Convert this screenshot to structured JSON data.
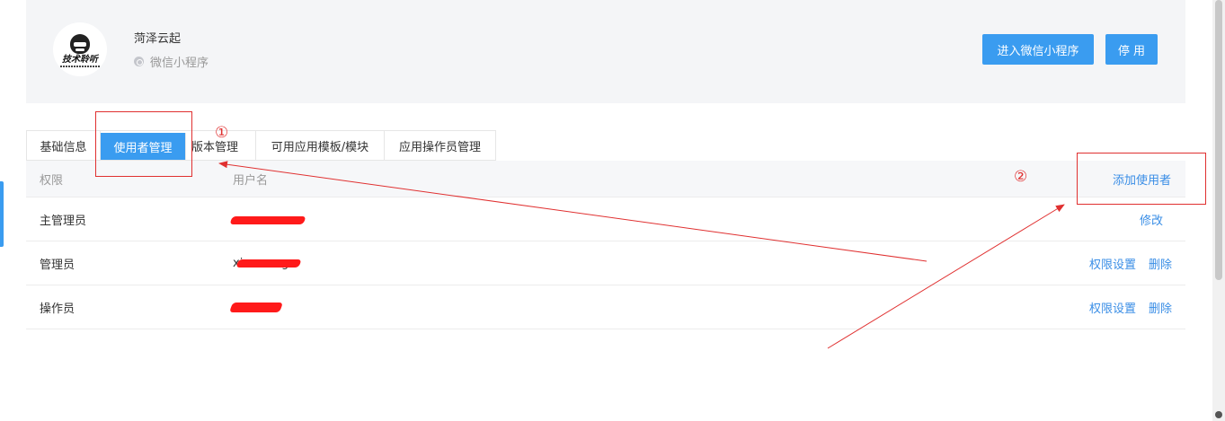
{
  "app": {
    "name": "菏泽云起",
    "type": "微信小程序",
    "logo_text": "技术聆听",
    "buttons": {
      "enter": "进入微信小程序",
      "disable": "停 用"
    }
  },
  "tabs": [
    {
      "label": "基础信息",
      "active": false
    },
    {
      "label": "使用者管理",
      "active": true
    },
    {
      "label": "版本管理",
      "active": false
    },
    {
      "label": "可用应用模板/模块",
      "active": false
    },
    {
      "label": "应用操作员管理",
      "active": false
    }
  ],
  "table": {
    "headers": {
      "role": "权限",
      "username": "用户名",
      "add": "添加使用者"
    },
    "rows": [
      {
        "role": "主管理员",
        "username_prefix": "",
        "username_suffix": "",
        "actions": [
          "修改"
        ]
      },
      {
        "role": "管理员",
        "username_prefix": "xi",
        "username_suffix": "g",
        "actions": [
          "权限设置",
          "删除"
        ]
      },
      {
        "role": "操作员",
        "username_prefix": "",
        "username_suffix": "",
        "actions": [
          "权限设置",
          "删除"
        ]
      }
    ]
  },
  "annotations": {
    "num1": "①",
    "num2": "②"
  },
  "colors": {
    "primary": "#3a9cf0",
    "link": "#3a8ee6",
    "annotation": "#e03030",
    "redaction": "#ff1a1a"
  }
}
